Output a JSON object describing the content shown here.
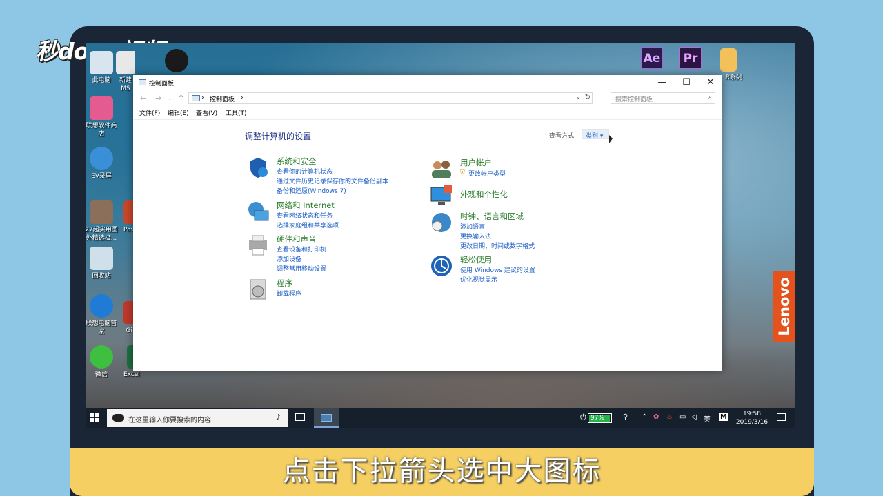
{
  "caption": "点击下拉箭头选中大图标",
  "brand": {
    "logo": "秒dong视频",
    "laptop_brand": "Lenovo"
  },
  "desktop": {
    "icons": [
      {
        "label": "此电脑"
      },
      {
        "label": "新建\nMS"
      },
      {
        "label": "联想软件商店"
      },
      {
        "label": "EV录屏"
      },
      {
        "label": "27超实用图外精选极..."
      },
      {
        "label": "回收站"
      },
      {
        "label": "联想电脑管家"
      },
      {
        "label": "微信"
      },
      {
        "label": "Excel"
      },
      {
        "label": "Pov"
      },
      {
        "label": "Gi"
      },
      {
        "label": "R系列"
      }
    ],
    "apps": [
      {
        "label": "Ae"
      },
      {
        "label": "Pr"
      }
    ]
  },
  "window": {
    "title": "控制面板",
    "controls": {
      "minimize": "—",
      "maximize": "☐",
      "close": "✕"
    },
    "address": {
      "path": "控制面板",
      "separator": "›"
    },
    "search_placeholder": "搜索控制面板",
    "menu": [
      "文件(F)",
      "编辑(E)",
      "查看(V)",
      "工具(T)"
    ],
    "heading": "调整计算机的设置",
    "view_by_label": "查看方式:",
    "view_by_value": "类别 ▾",
    "categories": [
      {
        "title": "系统和安全",
        "links": [
          "查看你的计算机状态",
          "通过文件历史记录保存你的文件备份副本",
          "备份和还原(Windows 7)"
        ]
      },
      {
        "title": "网络和 Internet",
        "links": [
          "查看网络状态和任务",
          "选择家庭组和共享选项"
        ]
      },
      {
        "title": "硬件和声音",
        "links": [
          "查看设备和打印机",
          "添加设备",
          "调整常用移动设置"
        ]
      },
      {
        "title": "程序",
        "links": [
          "卸载程序"
        ]
      },
      {
        "title": "用户帐户",
        "links": [
          "更改帐户类型"
        ]
      },
      {
        "title": "外观和个性化",
        "links": []
      },
      {
        "title": "时钟、语言和区域",
        "links": [
          "添加语言",
          "更换输入法",
          "更改日期、时间或数字格式"
        ]
      },
      {
        "title": "轻松使用",
        "links": [
          "使用 Windows 建议的设置",
          "优化视觉显示"
        ]
      }
    ]
  },
  "taskbar": {
    "search_placeholder": "在这里输入你要搜索的内容",
    "battery_percent": "97%",
    "battery_level": 0.97,
    "ime_lang": "英",
    "ime_mode": "M",
    "time": "19:58",
    "date": "2019/3/16"
  }
}
